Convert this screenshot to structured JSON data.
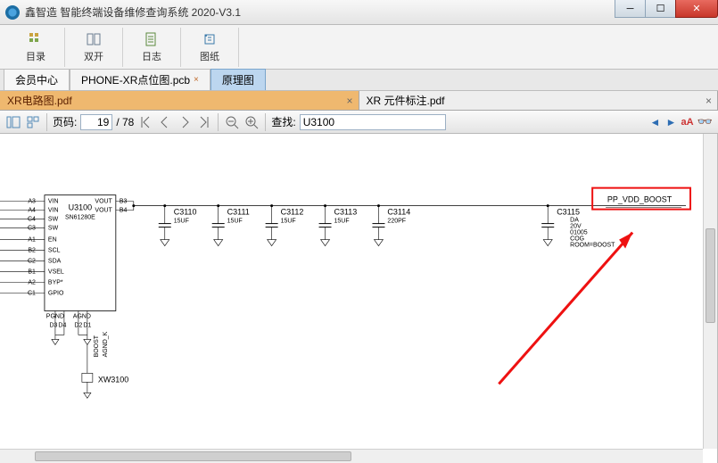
{
  "app": {
    "title": "鑫智造 智能终端设备维修查询系统 2020-V3.1"
  },
  "toolbar": {
    "btn_catalog": "目录",
    "btn_dual": "双开",
    "btn_log": "日志",
    "btn_drawing": "图纸"
  },
  "main_tabs": {
    "member": "会员中心",
    "pcb": "PHONE-XR点位图.pcb",
    "schem": "原理图"
  },
  "sub_tabs": {
    "left": "XR电路图.pdf",
    "right": "XR 元件标注.pdf"
  },
  "pdfbar": {
    "page_label": "页码:",
    "page_current": "19",
    "page_total": "/ 78",
    "find_label": "查找:",
    "find_value": "U3100",
    "match_case": "aA"
  },
  "schematic": {
    "chip_ref": "U3100",
    "chip_part": "SN61280E",
    "pins_left": [
      "VIN",
      "VIN",
      "SW",
      "SW",
      "EN",
      "SCL",
      "SDA",
      "VSEL",
      "BYP*",
      "GPIO"
    ],
    "pins_left_des": [
      "A3",
      "A4",
      "C4",
      "C3",
      "A1",
      "B2",
      "C2",
      "B1",
      "A2",
      "C1"
    ],
    "pins_right_top": [
      "VOUT",
      "VOUT"
    ],
    "pins_right_top_des": [
      "B3",
      "B4"
    ],
    "pins_bottom": [
      "PGND",
      "AGND"
    ],
    "pins_bottom_des": [
      "D3",
      "D4",
      "D2",
      "D1"
    ],
    "pins_boost_agnd": [
      "BOOST",
      "AGND_K"
    ],
    "xtal": "XW3100",
    "caps": [
      {
        "ref": "C3110",
        "val": "15UF"
      },
      {
        "ref": "C3111",
        "val": "15UF"
      },
      {
        "ref": "C3112",
        "val": "15UF"
      },
      {
        "ref": "C3113",
        "val": "15UF"
      },
      {
        "ref": "C3114",
        "val": "220PF"
      },
      {
        "ref": "C3115",
        "val": ""
      }
    ],
    "c3115_notes": [
      "DA",
      "20V",
      "01005",
      "COG",
      "ROOM=BOOST"
    ],
    "net_name": "PP_VDD_BOOST"
  }
}
